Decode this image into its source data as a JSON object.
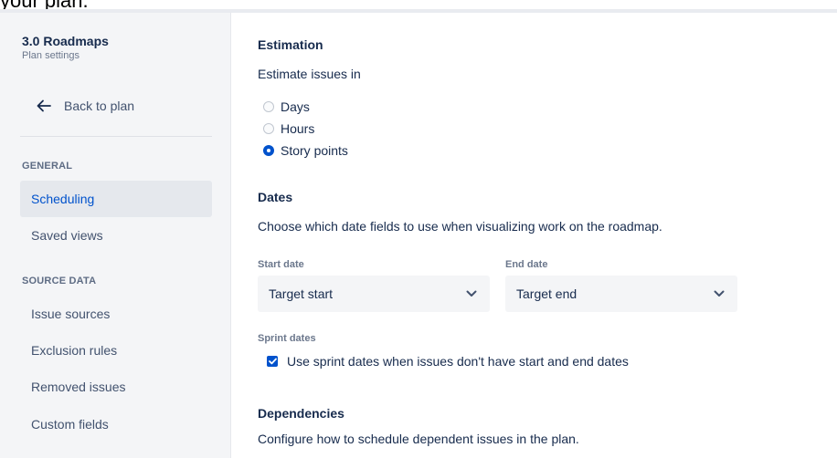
{
  "top_cut_text": "your plan.",
  "sidebar": {
    "plan_title": "3.0 Roadmaps",
    "plan_subtitle": "Plan settings",
    "back_label": "Back to plan",
    "sections": [
      {
        "label": "GENERAL",
        "items": [
          {
            "label": "Scheduling",
            "active": true
          },
          {
            "label": "Saved views",
            "active": false
          }
        ]
      },
      {
        "label": "SOURCE DATA",
        "items": [
          {
            "label": "Issue sources",
            "active": false
          },
          {
            "label": "Exclusion rules",
            "active": false
          },
          {
            "label": "Removed issues",
            "active": false
          },
          {
            "label": "Custom fields",
            "active": false
          }
        ]
      }
    ]
  },
  "estimation": {
    "heading": "Estimation",
    "description": "Estimate issues in",
    "options": [
      {
        "label": "Days",
        "checked": false
      },
      {
        "label": "Hours",
        "checked": false
      },
      {
        "label": "Story points",
        "checked": true
      }
    ]
  },
  "dates": {
    "heading": "Dates",
    "description": "Choose which date fields to use when visualizing work on the roadmap.",
    "start_label": "Start date",
    "start_value": "Target start",
    "end_label": "End date",
    "end_value": "Target end",
    "sprint_label": "Sprint dates",
    "sprint_checkbox_label": "Use sprint dates when issues don't have start and end dates",
    "sprint_checked": true
  },
  "dependencies": {
    "heading": "Dependencies",
    "description": "Configure how to schedule dependent issues in the plan."
  },
  "colors": {
    "accent": "#0052cc",
    "sidebar_bg": "#f4f5f7",
    "text": "#172b4d"
  }
}
